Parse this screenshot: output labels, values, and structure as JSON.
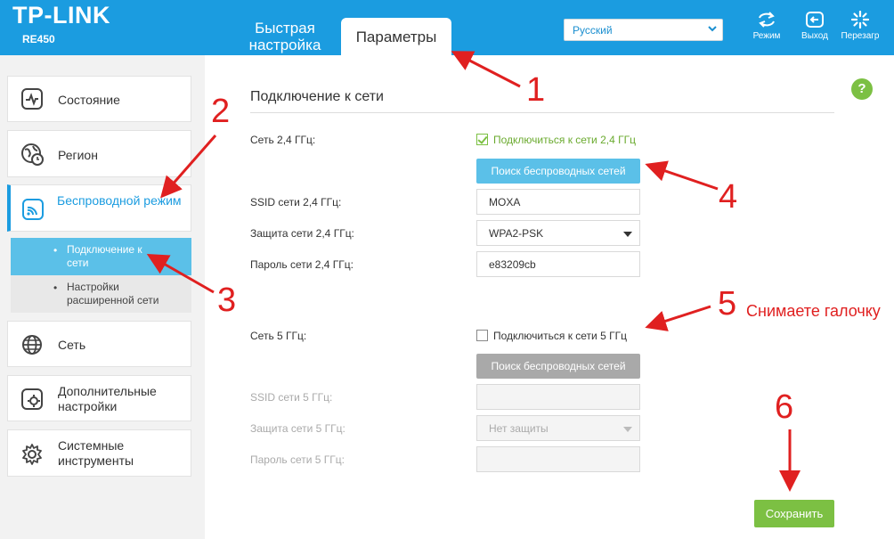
{
  "header": {
    "brand": "TP-LINK",
    "model": "RE450",
    "tabs": [
      {
        "label": "Быстрая настройка"
      },
      {
        "label": "Параметры"
      }
    ],
    "language": "Русский",
    "buttons": [
      {
        "label": "Режим",
        "icon": "mode-icon"
      },
      {
        "label": "Выход",
        "icon": "logout-icon"
      },
      {
        "label": "Перезагр",
        "icon": "reboot-icon"
      }
    ]
  },
  "sidebar": {
    "items": [
      {
        "label": "Состояние",
        "icon": "status-icon"
      },
      {
        "label": "Регион",
        "icon": "region-icon"
      },
      {
        "label": "Беспроводной режим",
        "icon": "wireless-icon"
      },
      {
        "label": "Сеть",
        "icon": "network-icon"
      },
      {
        "label": "Дополнительные настройки",
        "icon": "advanced-icon"
      },
      {
        "label": "Системные инструменты",
        "icon": "tools-icon"
      }
    ],
    "subitems": [
      {
        "label": "Подключение к сети"
      },
      {
        "label": "Настройки расширенной сети"
      }
    ]
  },
  "form": {
    "title": "Подключение к сети",
    "help": "?",
    "band24": {
      "label": "Сеть 2,4 ГГц:",
      "checkbox_label": "Подключиться к сети 2,4 ГГц",
      "checked": true,
      "scan_button": "Поиск беспроводных сетей",
      "ssid_label": "SSID сети 2,4 ГГц:",
      "ssid_value": "MOXA",
      "security_label": "Защита сети 2,4 ГГц:",
      "security_value": "WPA2-PSK",
      "password_label": "Пароль сети 2,4 ГГц:",
      "password_value": "e83209cb"
    },
    "band5": {
      "label": "Сеть 5 ГГц:",
      "checkbox_label": "Подключиться к сети 5 ГГц",
      "checked": false,
      "scan_button": "Поиск беспроводных сетей",
      "ssid_label": "SSID сети 5 ГГц:",
      "ssid_value": "",
      "security_label": "Защита сети 5 ГГц:",
      "security_value": "Нет защиты",
      "password_label": "Пароль сети 5 ГГц:",
      "password_value": ""
    },
    "save_button": "Сохранить"
  },
  "annotations": {
    "numbers": [
      "1",
      "2",
      "3",
      "4",
      "5",
      "6"
    ],
    "note": "Снимаете галочку"
  },
  "colors": {
    "header": "#1b9ce0",
    "accent_green": "#7cc043",
    "button_blue": "#5bc0e8",
    "annotation": "#e02020"
  }
}
